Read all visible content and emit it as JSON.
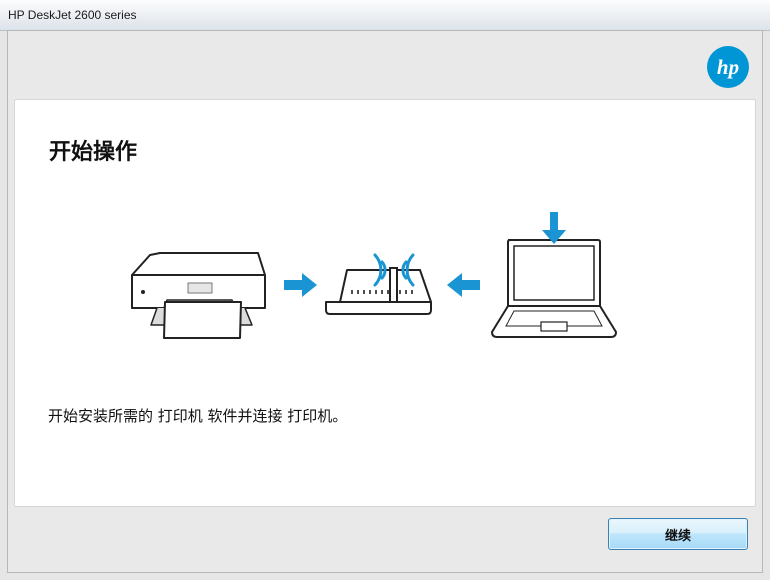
{
  "window": {
    "title": "HP DeskJet 2600 series"
  },
  "brand": {
    "logo_icon": "hp-logo-icon",
    "logo_text": "hp",
    "color": "#0096d6"
  },
  "page": {
    "heading": "开始操作",
    "description": "开始安装所需的 打印机 软件并连接 打印机。"
  },
  "illustration": {
    "items": [
      "printer-icon",
      "arrow-right-icon",
      "router-icon",
      "arrow-left-icon",
      "laptop-icon"
    ],
    "accent": "#1a94d2"
  },
  "footer": {
    "continue_label": "继续"
  }
}
